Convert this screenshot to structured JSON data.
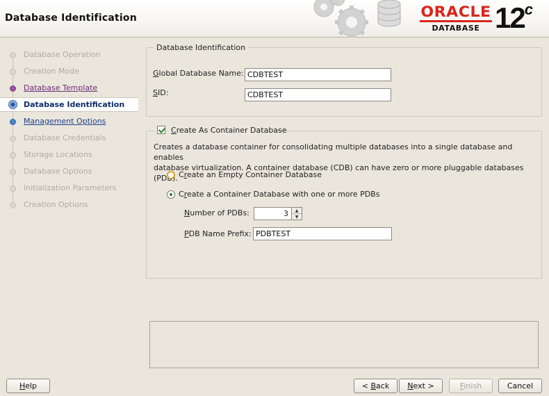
{
  "window": {
    "title": "Database Identification"
  },
  "branding": {
    "logo_text": "ORACLE",
    "product_text": "DATABASE",
    "version_number": "12",
    "version_suffix": "c",
    "brand_color": "#d9251c"
  },
  "steps": [
    {
      "label": "Database Operation",
      "state": "disabled"
    },
    {
      "label": "Creation Mode",
      "state": "disabled"
    },
    {
      "label": "Database Template",
      "state": "visited"
    },
    {
      "label": "Database Identification",
      "state": "current"
    },
    {
      "label": "Management Options",
      "state": "enabled"
    },
    {
      "label": "Database Credentials",
      "state": "disabled"
    },
    {
      "label": "Storage Locations",
      "state": "disabled"
    },
    {
      "label": "Database Options",
      "state": "disabled"
    },
    {
      "label": "Initialization Parameters",
      "state": "disabled"
    },
    {
      "label": "Creation Options",
      "state": "disabled"
    }
  ],
  "identification": {
    "group_title": "Database Identification",
    "global_name_label_mnemonic": "G",
    "global_name_label_rest": "lobal Database Name:",
    "global_name_value": "CDBTEST",
    "sid_label_mnemonic": "S",
    "sid_label_rest": "ID:",
    "sid_value": "CDBTEST"
  },
  "container": {
    "checkbox_label_mnemonic": "C",
    "checkbox_label_rest": "reate As Container Database",
    "checked": true,
    "description_line1": "Creates a database container for consolidating multiple databases into a single database and enables",
    "description_line2": "database virtualization. A container database (CDB) can have zero or more pluggable databases (PDB).",
    "option_empty_mnemonic": "r",
    "option_empty_pre": "C",
    "option_empty_rest": "eate an Empty Container Database",
    "option_pdbs_mnemonic": "r",
    "option_pdbs_pre": "C",
    "option_pdbs_rest": "eate a Container Database with one or more PDBs",
    "selected_option": "pdbs",
    "num_pdbs_label_mnemonic": "N",
    "num_pdbs_label_rest": "umber of PDBs:",
    "num_pdbs_value": "3",
    "pdb_prefix_label_mnemonic": "P",
    "pdb_prefix_label_rest": "DB Name Prefix:",
    "pdb_prefix_value": "PDBTEST"
  },
  "buttons": {
    "help_mnemonic": "H",
    "help_rest": "elp",
    "back_pre": "< ",
    "back_mnemonic": "B",
    "back_rest": "ack",
    "next_mnemonic": "N",
    "next_rest": "ext >",
    "finish_mnemonic": "F",
    "finish_rest": "inish",
    "cancel_label": "Cancel"
  },
  "icons": {
    "gears": "gears-icon",
    "database": "database-cylinder-icon",
    "spin_up": "arrow-up-icon",
    "spin_down": "arrow-down-icon"
  }
}
